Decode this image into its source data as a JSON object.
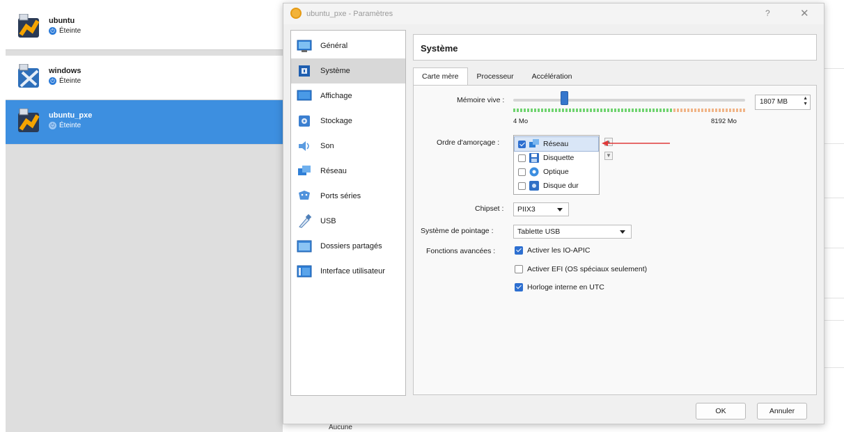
{
  "vm_list": {
    "items": [
      {
        "name": "ubuntu",
        "state": "Éteinte",
        "selected": false
      },
      {
        "name": "windows",
        "state": "Éteinte",
        "selected": false
      },
      {
        "name": "ubuntu_pxe",
        "state": "Éteinte",
        "selected": true
      }
    ]
  },
  "below_dialog_text": "Aucune",
  "dialog": {
    "title": "ubuntu_pxe - Paramètres",
    "help_label": "?",
    "close_label": "✕",
    "categories": [
      {
        "label": "Général",
        "icon": "general-icon"
      },
      {
        "label": "Système",
        "icon": "system-icon",
        "selected": true
      },
      {
        "label": "Affichage",
        "icon": "display-icon"
      },
      {
        "label": "Stockage",
        "icon": "storage-icon"
      },
      {
        "label": "Son",
        "icon": "audio-icon"
      },
      {
        "label": "Réseau",
        "icon": "network-icon"
      },
      {
        "label": "Ports séries",
        "icon": "serial-ports-icon"
      },
      {
        "label": "USB",
        "icon": "usb-icon"
      },
      {
        "label": "Dossiers partagés",
        "icon": "shared-folders-icon"
      },
      {
        "label": "Interface utilisateur",
        "icon": "user-interface-icon"
      }
    ],
    "panel_title": "Système",
    "tabs": [
      {
        "label": "Carte mère",
        "active": true
      },
      {
        "label": "Processeur",
        "active": false
      },
      {
        "label": "Accélération",
        "active": false
      }
    ],
    "motherboard": {
      "memory_label": "Mémoire vive :",
      "memory_value": "1807 MB",
      "memory_value_fraction": 0.22,
      "memory_min_label": "4 Mo",
      "memory_max_label": "8192 Mo",
      "boot_order_label": "Ordre d'amorçage :",
      "boot_items": [
        {
          "label": "Réseau",
          "checked": true,
          "selected": true,
          "icon": "network-boot-icon"
        },
        {
          "label": "Disquette",
          "checked": false,
          "icon": "floppy-icon"
        },
        {
          "label": "Optique",
          "checked": false,
          "icon": "optical-icon"
        },
        {
          "label": "Disque dur",
          "checked": false,
          "icon": "hard-disk-icon"
        }
      ],
      "move_up_label": "▲",
      "move_down_label": "▼",
      "chipset_label": "Chipset :",
      "chipset_value": "PIIX3",
      "pointing_label": "Système de pointage :",
      "pointing_value": "Tablette USB",
      "features_label": "Fonctions avancées :",
      "features": [
        {
          "label": "Activer les IO-APIC",
          "checked": true
        },
        {
          "label": "Activer EFI (OS spéciaux seulement)",
          "checked": false
        },
        {
          "label": "Horloge interne en UTC",
          "checked": true
        }
      ]
    },
    "ok_label": "OK",
    "cancel_label": "Annuler"
  },
  "colors": {
    "selection_blue": "#3d8fe0",
    "checkbox_blue": "#2d6fd0",
    "annotation_red": "#e03a3a"
  }
}
